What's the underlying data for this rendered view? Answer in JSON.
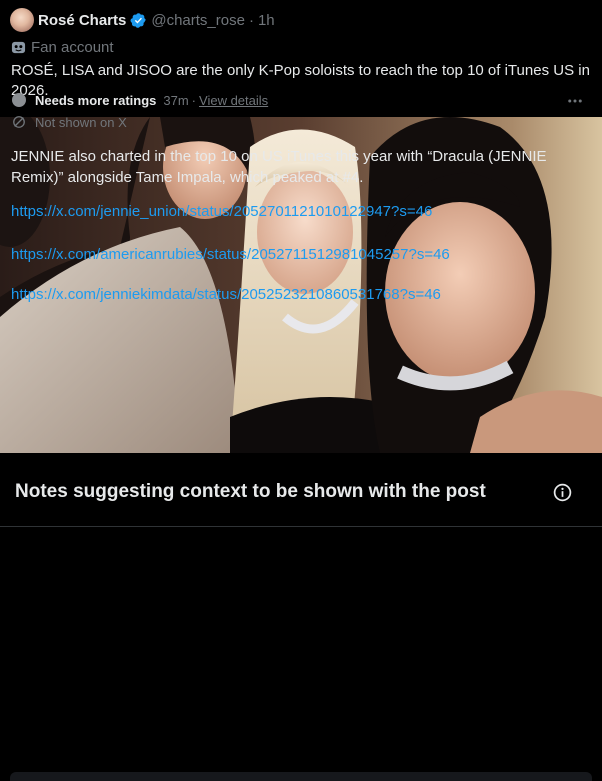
{
  "tweet": {
    "display_name": "Rosé Charts",
    "handle": "@charts_rose",
    "separator": "·",
    "time": "1h",
    "label": "Fan account",
    "text": "ROSÉ, LISA and JISOO are the only K-Pop soloists to reach the top 10 of iTunes US in 2026.",
    "verified_color": "#1d9bf0"
  },
  "notes": {
    "title": "Notes suggesting context to be shown with the post",
    "note": {
      "status": "Needs more ratings",
      "time": "37m",
      "separator": "·",
      "details_link": "View details",
      "visibility": "Not shown on X",
      "text": "JENNIE also charted in the top 10 on US iTunes this year with “Dracula (JENNIE Remix)” alongside Tame Impala, which peaked at #4.",
      "links": [
        "https://x.com/jennie_union/status/2052701121010122947?s=46",
        "https://x.com/americanrubies/status/2052711512981045257?s=46",
        "https://x.com/jenniekimdata/status/2052523210860531768?s=46"
      ]
    }
  },
  "colors": {
    "background": "#000000",
    "text": "#e7e9ea",
    "muted": "#71767b",
    "link": "#1d9bf0",
    "border": "#2f3336"
  },
  "icons": [
    "verified-badge-icon",
    "mask-icon",
    "info-icon",
    "more-icon",
    "eye-off-icon"
  ]
}
